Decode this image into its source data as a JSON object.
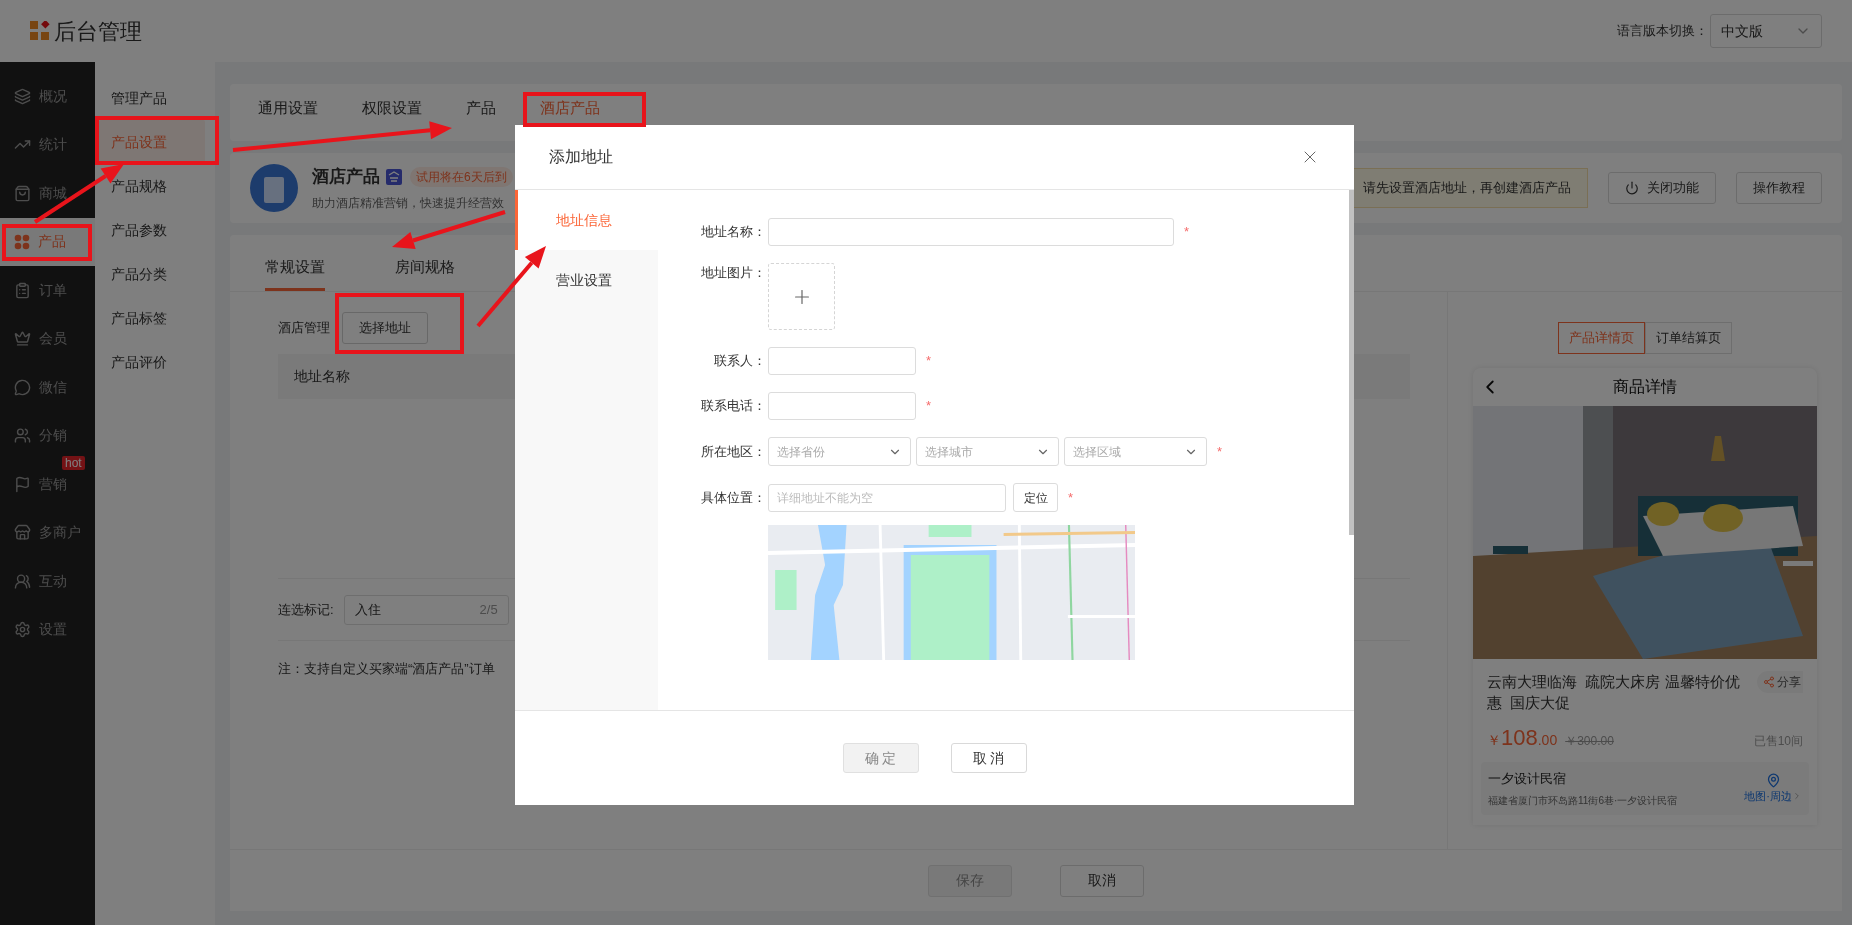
{
  "header": {
    "title": "后台管理",
    "language_label": "语言版本切换：",
    "language_value": "中文版"
  },
  "main_nav": [
    {
      "label": "概况",
      "selected": false
    },
    {
      "label": "统计",
      "selected": false
    },
    {
      "label": "商城",
      "selected": false
    },
    {
      "label": "产品",
      "selected": true
    },
    {
      "label": "订单",
      "selected": false
    },
    {
      "label": "会员",
      "selected": false
    },
    {
      "label": "微信",
      "selected": false
    },
    {
      "label": "分销",
      "selected": false
    },
    {
      "label": "营销",
      "selected": false,
      "badge": "hot"
    },
    {
      "label": "多商户",
      "selected": false
    },
    {
      "label": "互动",
      "selected": false
    },
    {
      "label": "设置",
      "selected": false
    }
  ],
  "sub_nav": [
    {
      "label": "管理产品",
      "selected": false
    },
    {
      "label": "产品设置",
      "selected": true
    },
    {
      "label": "产品规格",
      "selected": false
    },
    {
      "label": "产品参数",
      "selected": false
    },
    {
      "label": "产品分类",
      "selected": false
    },
    {
      "label": "产品标签",
      "selected": false
    },
    {
      "label": "产品评价",
      "selected": false
    }
  ],
  "top_tabs": [
    {
      "label": "通用设置",
      "selected": false
    },
    {
      "label": "权限设置",
      "selected": false
    },
    {
      "label": "产品",
      "selected": false
    },
    {
      "label": "酒店产品",
      "selected": true
    }
  ],
  "product_info": {
    "title": "酒店产品",
    "tag": "试用将在6天后到",
    "description": "助力酒店精准营销，快速提升经营效",
    "notice": "请先设置酒店地址，再创建酒店产品",
    "buttons": [
      {
        "kind": "power",
        "label": "关闭功能"
      },
      {
        "kind": "plain",
        "label": "操作教程"
      }
    ]
  },
  "settings_tabs": [
    {
      "label": "常规设置",
      "selected": true
    },
    {
      "label": "房间规格",
      "selected": false
    }
  ],
  "hotel_manage": {
    "label": "酒店管理",
    "button": "选择地址"
  },
  "table": {
    "columns": [
      "地址名称"
    ]
  },
  "mark_field": {
    "label": "连选标记:",
    "value": "入住",
    "count": "2/5"
  },
  "note": "注：支持自定义买家端“酒店产品”订单",
  "preview": {
    "tabs": [
      {
        "label": "产品详情页",
        "selected": true
      },
      {
        "label": "订单结算页",
        "selected": false
      }
    ],
    "title": "商品详情",
    "product_name": "云南大理临海  疏院大床房 温馨特价优惠  国庆大促",
    "share": "分享",
    "price_symbol": "￥",
    "price_int": "108",
    "price_dec": ".00",
    "original_price": "￥300.00",
    "sold": "已售10间",
    "shop_name": "一夕设计民宿",
    "shop_address": "福建省厦门市环岛路11街6巷·一夕设计民宿",
    "map_link": "地图·周边"
  },
  "footer_buttons": [
    {
      "label": "保存",
      "disabled": true
    },
    {
      "label": "取消",
      "disabled": false
    }
  ],
  "dialog": {
    "title": "添加地址",
    "nav": [
      {
        "label": "地址信息",
        "selected": true
      },
      {
        "label": "营业设置",
        "selected": false
      }
    ],
    "fields": [
      {
        "kind": "wide",
        "label": "地址名称：",
        "required_mark": "*"
      },
      {
        "label": "地址图片："
      },
      {
        "kind": "short",
        "label": "联系人：",
        "required_mark": "*"
      },
      {
        "kind": "short",
        "label": "联系电话：",
        "required_mark": "*"
      },
      {
        "kind": "region",
        "label": "所在地区：",
        "required_mark": "*",
        "placeholders": [
          "选择省份",
          "选择城市",
          "选择区域"
        ]
      },
      {
        "kind": "location",
        "label": "具体位置：",
        "required_mark": "*",
        "placeholder": "详细地址不能为空",
        "button": "定位"
      },
      {
        "kind": "map"
      }
    ],
    "buttons": [
      {
        "label": "确 定",
        "disabled": true
      },
      {
        "label": "取 消",
        "disabled": false
      }
    ]
  }
}
